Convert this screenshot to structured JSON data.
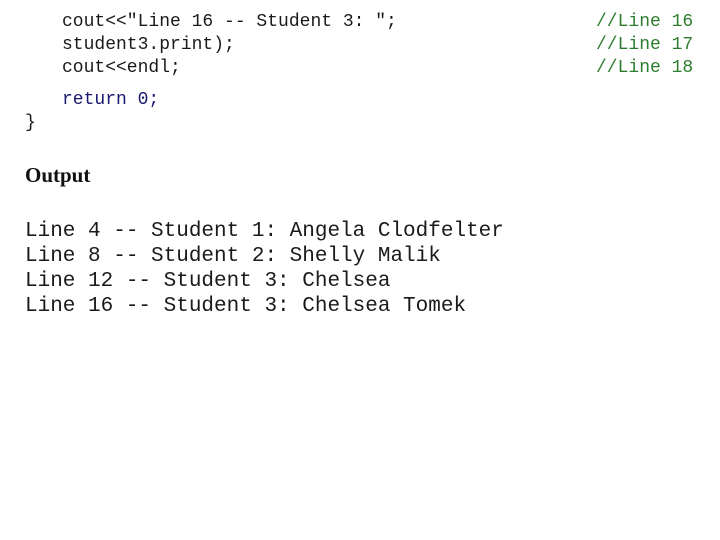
{
  "code": {
    "lines": [
      "cout<<\"Line 16 -- Student 3: \";",
      "student3.print);",
      "cout<<endl;",
      "return 0;",
      "}"
    ],
    "comments": [
      "//Line 16",
      "//Line 17",
      "//Line 18"
    ]
  },
  "output": {
    "heading": "Output",
    "lines": [
      "Line 4 -- Student 1: Angela Clodfelter",
      "Line 8 -- Student 2: Shelly Malik",
      "Line 12 -- Student 3: Chelsea",
      "Line 16 -- Student 3: Chelsea Tomek"
    ]
  },
  "colors": {
    "code_text": "#1a1a1a",
    "keyword": "#1a1a6e",
    "comment": "#2e7d2e"
  }
}
